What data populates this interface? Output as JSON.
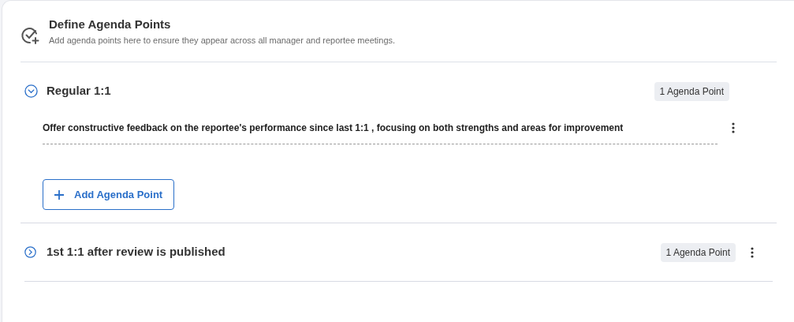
{
  "header": {
    "title": "Define Agenda Points",
    "subtitle": "Add agenda points here to ensure they appear across all manager and reportee meetings."
  },
  "sections": [
    {
      "title": "Regular 1:1",
      "badge": "1 Agenda Point",
      "expanded": true,
      "points": [
        "Offer constructive feedback on the reportee's performance since last 1:1 , focusing on both strengths and areas for improvement"
      ],
      "add_button": "Add Agenda Point"
    },
    {
      "title": "1st 1:1 after review is published",
      "badge": "1 Agenda Point",
      "expanded": false
    }
  ]
}
